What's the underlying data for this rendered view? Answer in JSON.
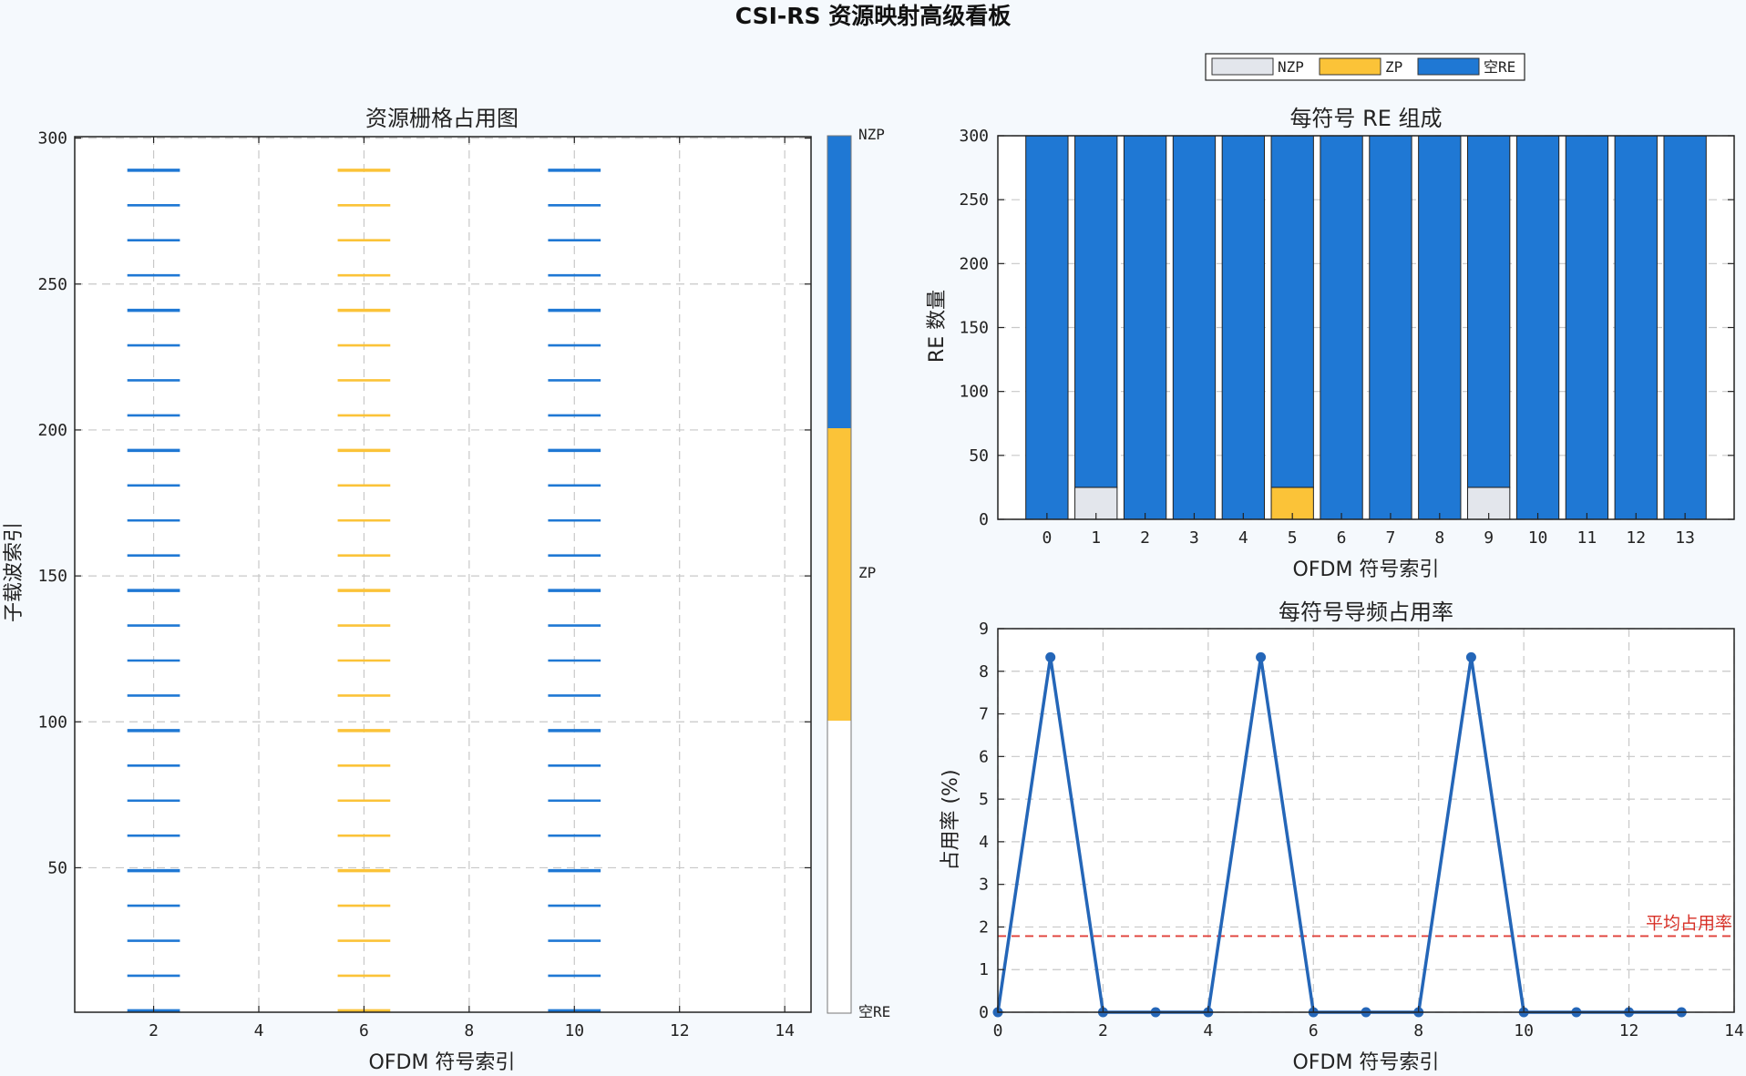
{
  "colors": {
    "nzp": "#e3e6ec",
    "zp": "#fbc338",
    "empty": "#1f78d4",
    "blank": "#ffffff",
    "line": "#2466b8",
    "avg": "#e0403a",
    "avg_text": "#d73027",
    "background": "#f5f9fd"
  },
  "chart_data": [
    {
      "type": "heatmap",
      "title": "资源栅格占用图",
      "xlabel": "OFDM 符号索引",
      "ylabel": "子载波索引",
      "xlim": [
        0.5,
        14.5
      ],
      "ylim": [
        0.5,
        300.5
      ],
      "xticks": [
        2,
        4,
        6,
        8,
        10,
        12,
        14
      ],
      "yticks": [
        50,
        100,
        150,
        200,
        250,
        300
      ],
      "grid": true,
      "symbols": [
        {
          "symbol": 1,
          "category": "NZP",
          "subcarriers_first": 1,
          "subcarriers_step": 12,
          "count": 25
        },
        {
          "symbol": 5,
          "category": "ZP",
          "subcarriers_first": 1,
          "subcarriers_step": 12,
          "count": 25
        },
        {
          "symbol": 9,
          "category": "NZP",
          "subcarriers_first": 1,
          "subcarriers_step": 12,
          "count": 25
        }
      ],
      "colorbar": {
        "labels": [
          "NZP",
          "ZP",
          "空RE"
        ],
        "segments": [
          "empty",
          "zp",
          "blank"
        ],
        "range": [
          0,
          3
        ]
      }
    },
    {
      "type": "bar",
      "stacked": true,
      "title": "每符号 RE 组成",
      "xlabel": "OFDM 符号索引",
      "ylabel": "RE 数量",
      "categories": [
        "0",
        "1",
        "2",
        "3",
        "4",
        "5",
        "6",
        "7",
        "8",
        "9",
        "10",
        "11",
        "12",
        "13"
      ],
      "ylim": [
        0,
        300
      ],
      "yticks": [
        0,
        50,
        100,
        150,
        200,
        250,
        300
      ],
      "grid": true,
      "legend_position": "above-right",
      "series": [
        {
          "name": "NZP",
          "values": [
            0,
            25,
            0,
            0,
            0,
            0,
            0,
            0,
            0,
            25,
            0,
            0,
            0,
            0
          ]
        },
        {
          "name": "ZP",
          "values": [
            0,
            0,
            0,
            0,
            0,
            25,
            0,
            0,
            0,
            0,
            0,
            0,
            0,
            0
          ]
        },
        {
          "name": "空RE",
          "values": [
            300,
            275,
            300,
            300,
            300,
            275,
            300,
            300,
            300,
            275,
            300,
            300,
            300,
            300
          ]
        }
      ]
    },
    {
      "type": "line",
      "title": "每符号导频占用率",
      "xlabel": "OFDM 符号索引",
      "ylabel": "占用率 (%)",
      "x": [
        0,
        1,
        2,
        3,
        4,
        5,
        6,
        7,
        8,
        9,
        10,
        11,
        12,
        13
      ],
      "y": [
        0,
        8.33,
        0,
        0,
        0,
        8.33,
        0,
        0,
        0,
        8.33,
        0,
        0,
        0,
        0
      ],
      "xlim": [
        0,
        14
      ],
      "ylim": [
        0,
        9
      ],
      "xticks": [
        0,
        2,
        4,
        6,
        8,
        10,
        12,
        14
      ],
      "yticks": [
        0,
        1,
        2,
        3,
        4,
        5,
        6,
        7,
        8,
        9
      ],
      "grid": true,
      "mean_line": {
        "value": 1.786,
        "label": "平均占用率"
      }
    }
  ],
  "figure": {
    "title": "CSI-RS 资源映射高级看板"
  }
}
